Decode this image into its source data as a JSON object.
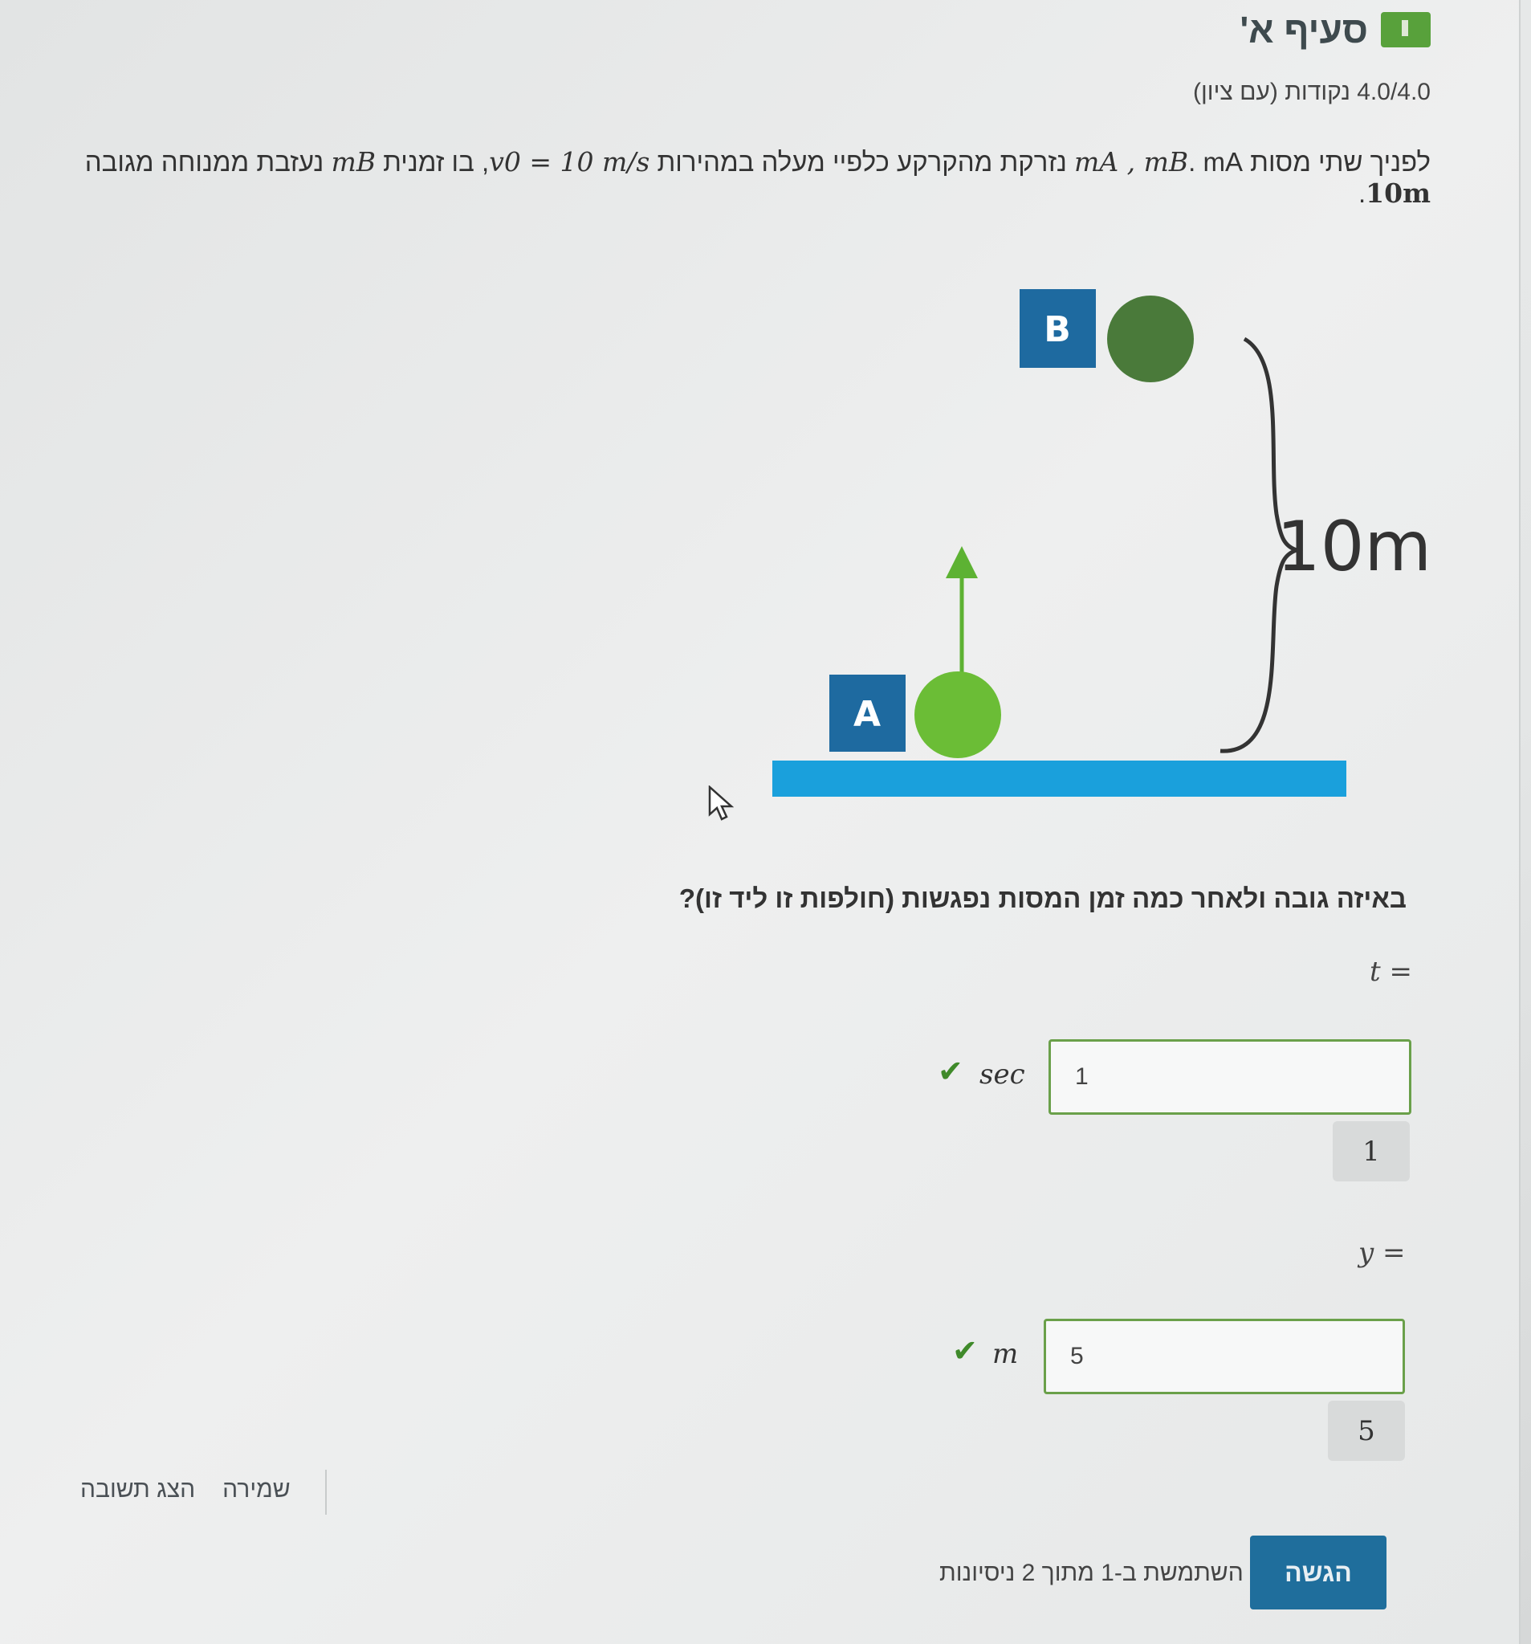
{
  "header": {
    "title": "סעיף א'",
    "points": "4.0/4.0 נקודות (עם ציון)"
  },
  "problem": {
    "text_1": "לפניך שתי מסות ",
    "masses": "mA , mB",
    "text_2": ". mA נזרקת מהקרקע כלפיי מעלה במהירות ",
    "v0": "v0 = 10 m/s",
    "text_3": ", בו זמנית ",
    "mb": "mB",
    "text_4": " נעזבת ממנוחה מגובה ",
    "height": "10m",
    "text_5": "."
  },
  "diagram": {
    "label_a": "A",
    "label_b": "B",
    "height_label": "10m",
    "colors": {
      "box": "#1e6aa0",
      "ball_a": "#6bbd36",
      "ball_b": "#4a7a3a",
      "ground": "#1aa0dc",
      "arrow": "#5db233"
    }
  },
  "question": "באיזה גובה ולאחר כמה זמן המסות נפגשות (חולפות זו ליד זו)?",
  "answers": [
    {
      "var": "t =",
      "value": "1",
      "unit": "sec",
      "feedback": "1"
    },
    {
      "var": "y =",
      "value": "5",
      "unit": "m",
      "feedback": "5"
    }
  ],
  "footer": {
    "save_label": "שמירה",
    "show_answer_label": "הצג תשובה",
    "attempts_text": "השתמשת ב-1 מתוך 2 ניסיונות",
    "submit_label": "הגשה"
  }
}
